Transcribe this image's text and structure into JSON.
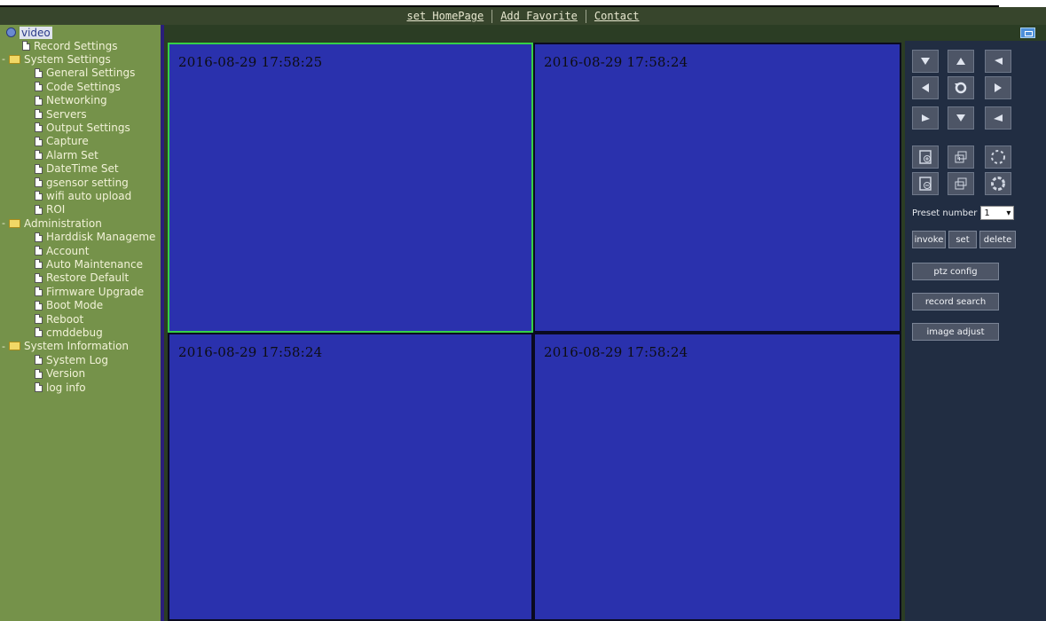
{
  "topbar": {
    "links": [
      "set HomePage",
      "Add Favorite",
      "Contact"
    ]
  },
  "sidebar": {
    "root": "video",
    "items": [
      {
        "label": "Record Settings",
        "type": "doc",
        "level": 1
      },
      {
        "label": "System Settings",
        "type": "folder",
        "level": 0
      },
      {
        "label": "General Settings",
        "type": "doc",
        "level": 2
      },
      {
        "label": "Code Settings",
        "type": "doc",
        "level": 2
      },
      {
        "label": "Networking",
        "type": "doc",
        "level": 2
      },
      {
        "label": "Servers",
        "type": "doc",
        "level": 2
      },
      {
        "label": "Output Settings",
        "type": "doc",
        "level": 2
      },
      {
        "label": "Capture",
        "type": "doc",
        "level": 2
      },
      {
        "label": "Alarm Set",
        "type": "doc",
        "level": 2
      },
      {
        "label": "DateTime Set",
        "type": "doc",
        "level": 2
      },
      {
        "label": "gsensor setting",
        "type": "doc",
        "level": 2
      },
      {
        "label": "wifi auto upload",
        "type": "doc",
        "level": 2
      },
      {
        "label": "ROI",
        "type": "doc",
        "level": 2
      },
      {
        "label": "Administration",
        "type": "folder",
        "level": 0
      },
      {
        "label": "Harddisk Manageme",
        "type": "doc",
        "level": 2
      },
      {
        "label": "Account",
        "type": "doc",
        "level": 2
      },
      {
        "label": "Auto Maintenance",
        "type": "doc",
        "level": 2
      },
      {
        "label": "Restore Default",
        "type": "doc",
        "level": 2
      },
      {
        "label": "Firmware Upgrade",
        "type": "doc",
        "level": 2
      },
      {
        "label": "Boot Mode",
        "type": "doc",
        "level": 2
      },
      {
        "label": "Reboot",
        "type": "doc",
        "level": 2
      },
      {
        "label": "cmddebug",
        "type": "doc",
        "level": 2
      },
      {
        "label": "System Information",
        "type": "folder",
        "level": 0
      },
      {
        "label": "System Log",
        "type": "doc",
        "level": 2
      },
      {
        "label": "Version",
        "type": "doc",
        "level": 2
      },
      {
        "label": "log info",
        "type": "doc",
        "level": 2
      }
    ]
  },
  "video_panes": [
    {
      "timestamp": "2016-08-29 17:58:25",
      "active": true
    },
    {
      "timestamp": "2016-08-29 17:58:24",
      "active": false
    },
    {
      "timestamp": "2016-08-29 17:58:24",
      "active": false
    },
    {
      "timestamp": "2016-08-29 17:58:24",
      "active": false
    }
  ],
  "ptz": {
    "preset_label": "Preset number",
    "preset_value": "1",
    "invoke_label": "invoke",
    "set_label": "set",
    "delete_label": "delete",
    "ptz_config_label": "ptz config",
    "record_search_label": "record search",
    "image_adjust_label": "image adjust"
  },
  "colors": {
    "sidebar_bg": "#75924a",
    "video_bg": "#2a31ad",
    "active_border": "#35d047",
    "panel_bg": "#212d42"
  }
}
